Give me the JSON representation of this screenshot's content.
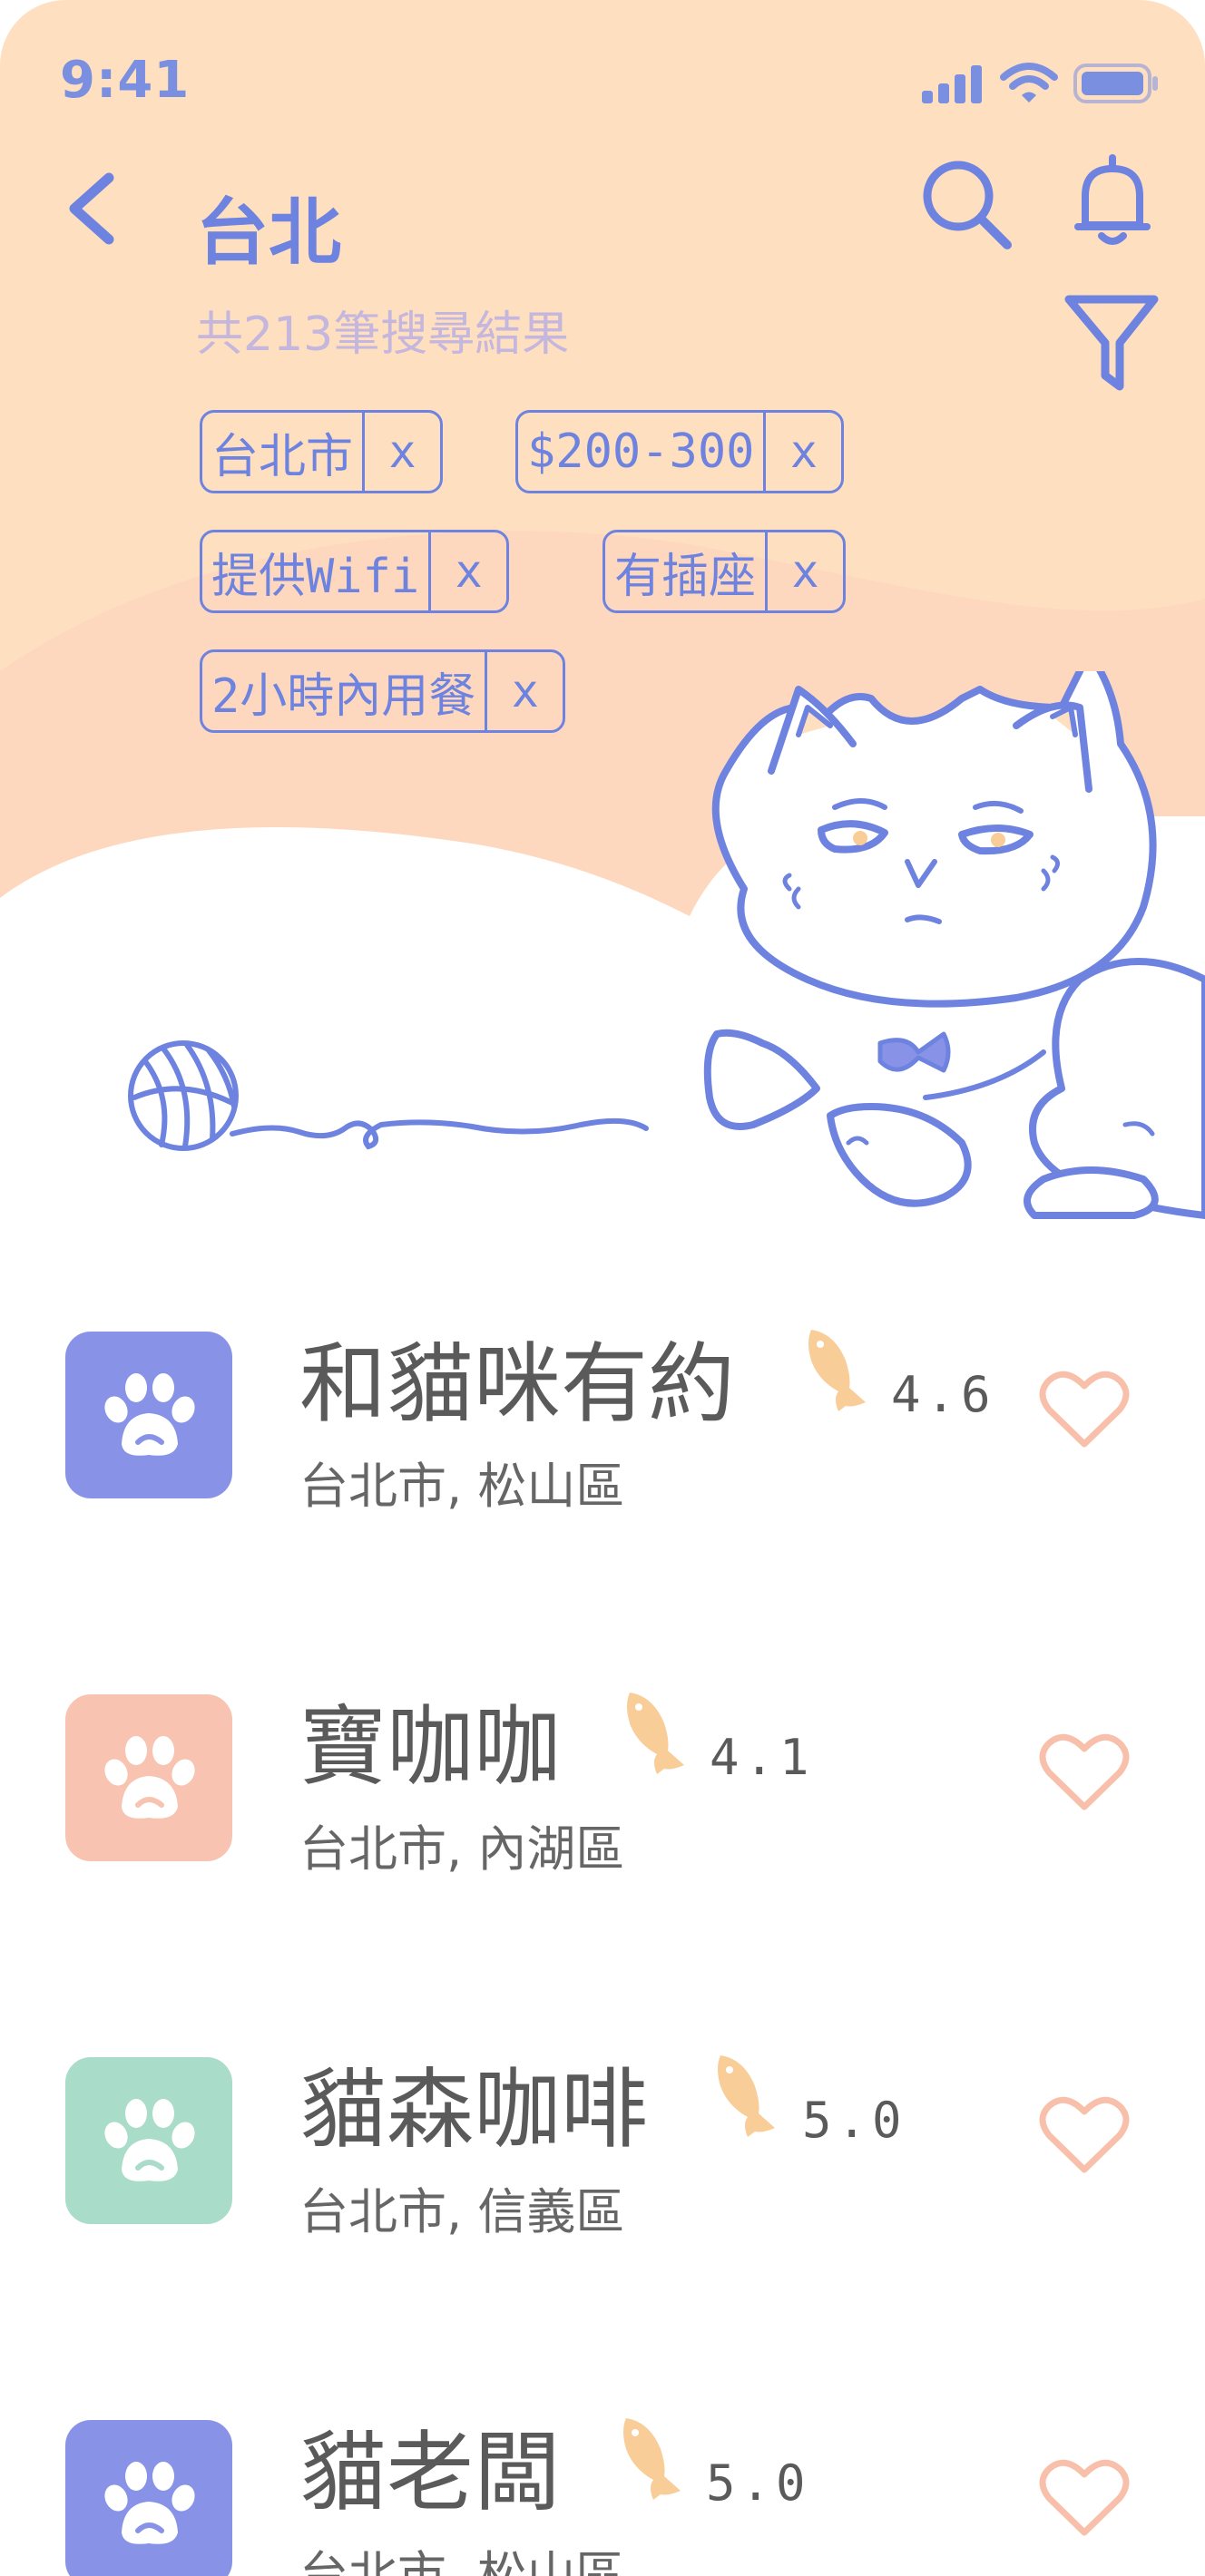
{
  "status_bar": {
    "time": "9:41"
  },
  "header": {
    "title": "台北",
    "result_count": "共213筆搜尋結果"
  },
  "filters": [
    {
      "label": "台北市",
      "remove": "x"
    },
    {
      "label": "$200-300",
      "remove": "x"
    },
    {
      "label": "提供Wifi",
      "remove": "x"
    },
    {
      "label": "有插座",
      "remove": "x"
    },
    {
      "label": "2小時內用餐",
      "remove": "x"
    }
  ],
  "cafes": [
    {
      "name": "和貓咪有約",
      "rating": "4.6",
      "location": "台北市, 松山區",
      "icon_color": "#8893e8",
      "icon": "paw-icon"
    },
    {
      "name": "寶咖咖",
      "rating": "4.1",
      "location": "台北市, 內湖區",
      "icon_color": "#f8c3b0",
      "icon": "paw-icon"
    },
    {
      "name": "貓森咖啡",
      "rating": "5.0",
      "location": "台北市, 信義區",
      "icon_color": "#a9dcc9",
      "icon": "paw-icon"
    },
    {
      "name": "貓老闆",
      "rating": "5.0",
      "location": "台北市, 松山區",
      "icon_color": "#8893e8",
      "icon": "paw-icon"
    }
  ],
  "colors": {
    "accent": "#6d83df",
    "header_bg": "#fedfc0",
    "heart": "#f8c0aa",
    "fish": "#f9cd98"
  }
}
